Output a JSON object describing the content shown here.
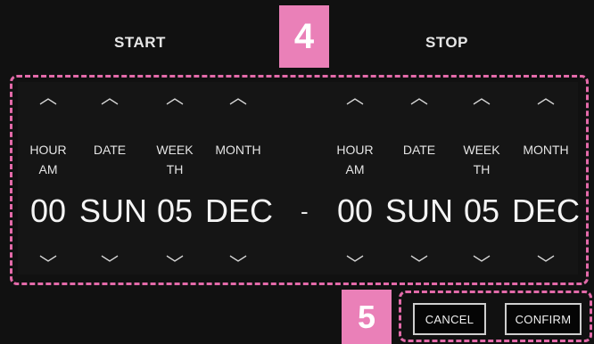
{
  "start": {
    "title": "START",
    "columns": [
      {
        "label_line1": "HOUR",
        "label_line2": "AM",
        "value": "00"
      },
      {
        "label_line1": "DATE",
        "label_line2": "",
        "value": "SUN"
      },
      {
        "label_line1": "WEEK",
        "label_line2": "TH",
        "value": "05"
      },
      {
        "label_line1": "MONTH",
        "label_line2": "",
        "value": "DEC"
      }
    ]
  },
  "stop": {
    "title": "STOP",
    "columns": [
      {
        "label_line1": "HOUR",
        "label_line2": "AM",
        "value": "00"
      },
      {
        "label_line1": "DATE",
        "label_line2": "",
        "value": "SUN"
      },
      {
        "label_line1": "WEEK",
        "label_line2": "TH",
        "value": "05"
      },
      {
        "label_line1": "MONTH",
        "label_line2": "",
        "value": "DEC"
      }
    ]
  },
  "separator": "-",
  "glyphs": {
    "up": "︿",
    "down": "﹀"
  },
  "annotations": {
    "badge_range": "4",
    "badge_buttons": "5"
  },
  "buttons": {
    "cancel": "CANCEL",
    "confirm": "CONFIRM"
  },
  "colors": {
    "background": "#111111",
    "annotation_pink": "#e36aa9",
    "badge_pink": "#ea80b8"
  }
}
